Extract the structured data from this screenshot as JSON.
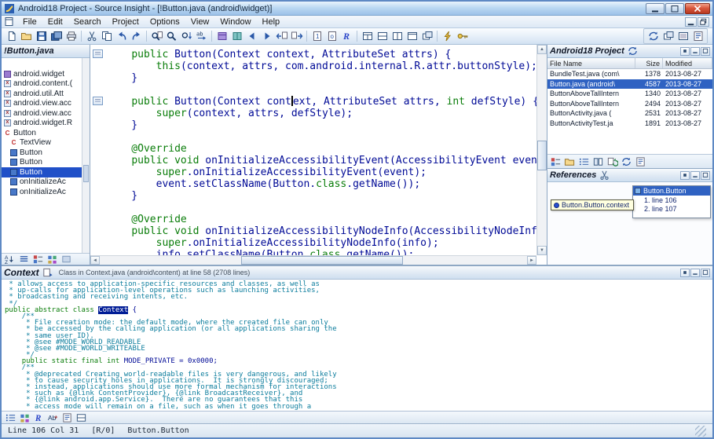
{
  "titlebar": {
    "title": "Android18 Project - Source Insight - [!Button.java (android\\widget)]"
  },
  "window_buttons": [
    "minimize",
    "maximize",
    "close"
  ],
  "mdi_buttons": [
    "minimize",
    "restore"
  ],
  "panel_buttons": [
    "pin",
    "minimize",
    "maximize"
  ],
  "menubar": {
    "items": [
      "File",
      "Edit",
      "Search",
      "Project",
      "Options",
      "View",
      "Window",
      "Help"
    ]
  },
  "toolbar": {
    "groups": [
      [
        "new-file-icon",
        "open-icon",
        "save-icon",
        "save-all-icon",
        "print-icon"
      ],
      [
        "cut-icon",
        "copy-icon",
        "undo-icon",
        "redo-icon"
      ],
      [
        "search-files-icon",
        "search-icon",
        "search-prev-icon",
        "replace-icon"
      ],
      [
        "symbol-browse-icon",
        "class-browse-icon",
        "back-icon",
        "forward-icon",
        "jump-caller-icon",
        "jump-def-icon"
      ],
      [
        "doc-toggle-ic",
        "doc-lock-icon",
        "references-icon"
      ],
      [
        "tile-windows-icon",
        "split-horiz-icon",
        "split-vert-icon",
        "full-window-icon",
        "activate-window-icon"
      ],
      [
        "lightning-icon",
        "keyboard-help-icon"
      ]
    ],
    "right_group": [
      "nav-cycle-icon",
      "activate-window-icon",
      "window-list-icon",
      "file-props-icon"
    ]
  },
  "symbol_window": {
    "title": "!Button.java",
    "items": [
      {
        "icon": "package-icon",
        "label": "android.widget",
        "indent": 0,
        "selected": false
      },
      {
        "icon": "import-icon",
        "label": "android.content.(",
        "indent": 0,
        "selected": false
      },
      {
        "icon": "import-icon",
        "label": "android.util.Att",
        "indent": 0,
        "selected": false
      },
      {
        "icon": "import-icon",
        "label": "android.view.acc",
        "indent": 0,
        "selected": false
      },
      {
        "icon": "import-icon",
        "label": "android.view.acc",
        "indent": 0,
        "selected": false
      },
      {
        "icon": "import-icon",
        "label": "android.widget.R",
        "indent": 0,
        "selected": false
      },
      {
        "icon": "class-icon",
        "label": "Button",
        "indent": 0,
        "selected": false
      },
      {
        "icon": "class-icon",
        "label": "TextView",
        "indent": 1,
        "selected": false
      },
      {
        "icon": "method-icon",
        "label": "Button",
        "indent": 1,
        "selected": false
      },
      {
        "icon": "method-icon",
        "label": "Button",
        "indent": 1,
        "selected": false
      },
      {
        "icon": "method-icon",
        "label": "Button",
        "indent": 1,
        "selected": true
      },
      {
        "icon": "method-icon",
        "label": "onInitializeAc",
        "indent": 1,
        "selected": false
      },
      {
        "icon": "method-icon",
        "label": "onInitializeAc",
        "indent": 1,
        "selected": false
      }
    ],
    "footer_icons": [
      "sort-az-icon",
      "view-list-icon",
      "view-symbols-icon",
      "view-grid-icon",
      "view-options-icon"
    ]
  },
  "editor": {
    "lines": [
      [
        [
          "p",
          "    "
        ],
        [
          "k",
          "public"
        ],
        [
          "p",
          " Button(Context context, AttributeSet attrs) {"
        ]
      ],
      [
        [
          "p",
          "        "
        ],
        [
          "k",
          "this"
        ],
        [
          "p",
          "(context, attrs, com.android.internal.R.attr.buttonStyle);"
        ]
      ],
      [
        [
          "p",
          "    }"
        ]
      ],
      [],
      [
        [
          "p",
          "    "
        ],
        [
          "k",
          "public"
        ],
        [
          "p",
          " Button(Context cont"
        ],
        [
          "caret",
          ""
        ],
        [
          "p",
          "ext, AttributeSet attrs, "
        ],
        [
          "k",
          "int"
        ],
        [
          "p",
          " defStyle) {"
        ]
      ],
      [
        [
          "p",
          "        "
        ],
        [
          "k",
          "super"
        ],
        [
          "p",
          "(context, attrs, defStyle);"
        ]
      ],
      [
        [
          "p",
          "    }"
        ]
      ],
      [],
      [
        [
          "a",
          "    @Override"
        ]
      ],
      [
        [
          "p",
          "    "
        ],
        [
          "k",
          "public"
        ],
        [
          "p",
          " "
        ],
        [
          "k",
          "void"
        ],
        [
          "p",
          " onInitializeAccessibilityEvent(AccessibilityEvent event"
        ]
      ],
      [
        [
          "p",
          "        "
        ],
        [
          "k",
          "super"
        ],
        [
          "p",
          ".onInitializeAccessibilityEvent(event);"
        ]
      ],
      [
        [
          "p",
          "        event.setClassName(Button."
        ],
        [
          "k",
          "class"
        ],
        [
          "p",
          ".getName());"
        ]
      ],
      [
        [
          "p",
          "    }"
        ]
      ],
      [],
      [
        [
          "a",
          "    @Override"
        ]
      ],
      [
        [
          "p",
          "    "
        ],
        [
          "k",
          "public"
        ],
        [
          "p",
          " "
        ],
        [
          "k",
          "void"
        ],
        [
          "p",
          " onInitializeAccessibilityNodeInfo(AccessibilityNodeInfo"
        ]
      ],
      [
        [
          "p",
          "        "
        ],
        [
          "k",
          "super"
        ],
        [
          "p",
          ".onInitializeAccessibilityNodeInfo(info);"
        ]
      ],
      [
        [
          "p",
          "        info.setClassName(Button."
        ],
        [
          "k",
          "class"
        ],
        [
          "p",
          ".getName());"
        ]
      ]
    ],
    "gutter_marker_lines": [
      0,
      4
    ]
  },
  "project_panel": {
    "title": "Android18 Project",
    "columns": [
      "File Name",
      "Size",
      "Modified"
    ],
    "files": [
      {
        "name": "BundleTest.java (com\\",
        "size": "1378",
        "modified": "2013-08-27",
        "selected": false
      },
      {
        "name": "Button.java (android\\",
        "size": "4587",
        "modified": "2013-08-27",
        "selected": true
      },
      {
        "name": "ButtonAboveTallIntern",
        "size": "1340",
        "modified": "2013-08-27",
        "selected": false
      },
      {
        "name": "ButtonAboveTallIntern",
        "size": "2494",
        "modified": "2013-08-27",
        "selected": false
      },
      {
        "name": "ButtonActivity.java (",
        "size": "2531",
        "modified": "2013-08-27",
        "selected": false
      },
      {
        "name": "ButtonActivityTest.ja",
        "size": "1891",
        "modified": "2013-08-27",
        "selected": false
      }
    ],
    "footer_icons": [
      "view-symbols-icon",
      "view-files-icon",
      "view-details-icon",
      "view-mixed-icon",
      "sync-file-icon",
      "refresh-icon",
      "file-props-icon"
    ]
  },
  "references_panel": {
    "title": "References",
    "tooltip": "Button.Button.context",
    "result_box": {
      "header": "Button.Button",
      "items": [
        "1. line 106",
        "2. line 107"
      ]
    }
  },
  "context_panel": {
    "title": "Context",
    "subtitle": "Class in Context.java (android\\content) at line 58 (2708 lines)",
    "lines": [
      [
        [
          "m",
          " * allows access to application-specific resources and classes, as well as"
        ]
      ],
      [
        [
          "m",
          " * up-calls for application-level operations such as launching activities,"
        ]
      ],
      [
        [
          "m",
          " * broadcasting and receiving intents, etc."
        ]
      ],
      [
        [
          "m",
          " */"
        ]
      ],
      [
        [
          "k",
          "public abstract class "
        ],
        [
          "hl",
          "Context"
        ],
        [
          "p",
          " {"
        ]
      ],
      [
        [
          "m",
          "    /**"
        ]
      ],
      [
        [
          "m",
          "     * File creation mode: the default mode, where the created file can only"
        ]
      ],
      [
        [
          "m",
          "     * be accessed by the calling application (or all applications sharing the"
        ]
      ],
      [
        [
          "m",
          "     * same user ID)."
        ]
      ],
      [
        [
          "m",
          "     * @see #MODE_WORLD_READABLE"
        ]
      ],
      [
        [
          "m",
          "     * @see #MODE_WORLD_WRITEABLE"
        ]
      ],
      [
        [
          "m",
          "     */"
        ]
      ],
      [
        [
          "p",
          "    "
        ],
        [
          "k",
          "public static final int"
        ],
        [
          "p",
          " MODE_PRIVATE = 0x0000;"
        ]
      ],
      [
        [
          "m",
          "    /**"
        ]
      ],
      [
        [
          "m",
          "     * @deprecated Creating world-readable files is very dangerous, and likely"
        ]
      ],
      [
        [
          "m",
          "     * to cause security holes in applications.  It is strongly discouraged;"
        ]
      ],
      [
        [
          "m",
          "     * instead, applications should use more formal mechanism for interactions"
        ]
      ],
      [
        [
          "m",
          "     * such as {@link ContentProvider}, {@link BroadcastReceiver}, and"
        ]
      ],
      [
        [
          "m",
          "     * {@link android.app.Service}.  There are no guarantees that this"
        ]
      ],
      [
        [
          "m",
          "     * access mode will remain on a file, such as when it goes through a"
        ]
      ]
    ],
    "footer_icons": [
      "symbol-list-icon",
      "view-grid-icon",
      "references-icon",
      "case-icon",
      "doc-list-icon",
      "window-split-icon"
    ]
  },
  "statusbar": {
    "line_col": "Line 106  Col 31",
    "mode": "[R/0]",
    "symbol": "Button.Button"
  }
}
